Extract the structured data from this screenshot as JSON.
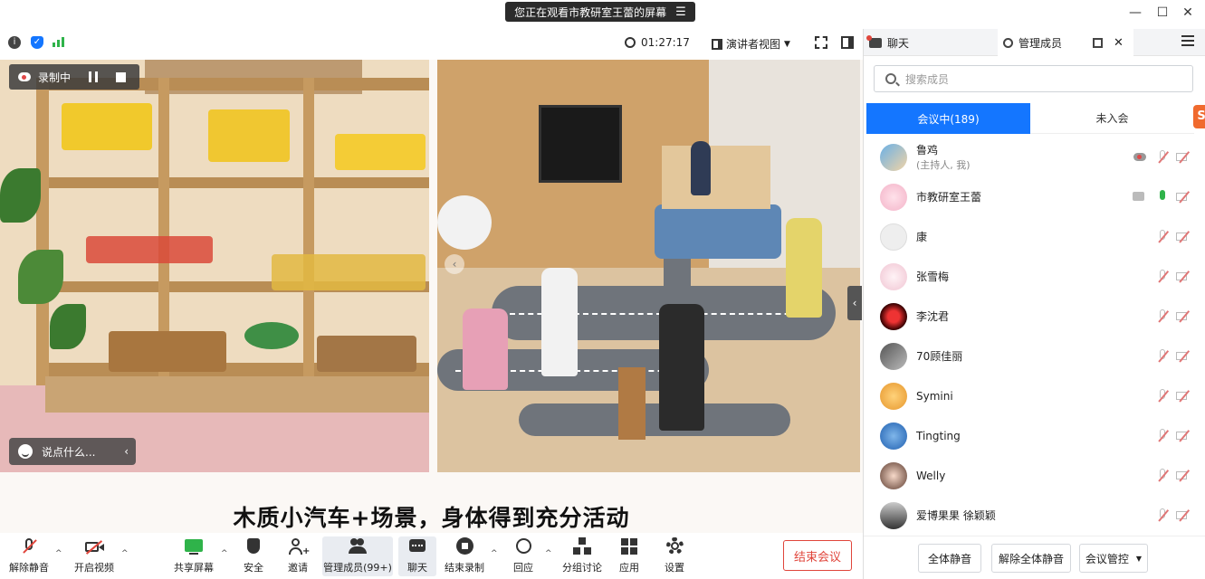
{
  "banner": {
    "text": "您正在观看市教研室王蕾的屏幕"
  },
  "infobar": {
    "timer": "01:27:17",
    "view_mode": "演讲者视图"
  },
  "recording": {
    "label": "录制中"
  },
  "chat_input": {
    "placeholder": "说点什么..."
  },
  "screen": {
    "caption": "木质小汽车+场景，身体得到充分活动"
  },
  "toolbar": {
    "mute": "解除静音",
    "video": "开启视频",
    "share": "共享屏幕",
    "security": "安全",
    "invite": "邀请",
    "members": "管理成员(99+)",
    "chat": "聊天",
    "record": "结束录制",
    "reactions": "回应",
    "breakout": "分组讨论",
    "apps": "应用",
    "settings": "设置",
    "end": "结束会议"
  },
  "panel": {
    "tab_chat": "聊天",
    "tab_members": "管理成员",
    "search_placeholder": "搜索成员",
    "seg_in_meeting": "会议中(189)",
    "seg_not_joined": "未入会",
    "members": [
      {
        "name": "鲁鸡",
        "sub": "(主持人, 我)"
      },
      {
        "name": "市教研室王蕾",
        "sub": ""
      },
      {
        "name": "康",
        "sub": ""
      },
      {
        "name": "张雪梅",
        "sub": ""
      },
      {
        "name": "李沈君",
        "sub": ""
      },
      {
        "name": "70顾佳丽",
        "sub": ""
      },
      {
        "name": "Symini",
        "sub": ""
      },
      {
        "name": "Tingting",
        "sub": ""
      },
      {
        "name": "Welly",
        "sub": ""
      },
      {
        "name": "爱博果果 徐颖颖",
        "sub": ""
      }
    ],
    "mute_all": "全体静音",
    "unmute_all": "解除全体静音",
    "meeting_control": "会议管控"
  },
  "colors": {
    "accent": "#1476ff",
    "danger": "#e0453b"
  }
}
